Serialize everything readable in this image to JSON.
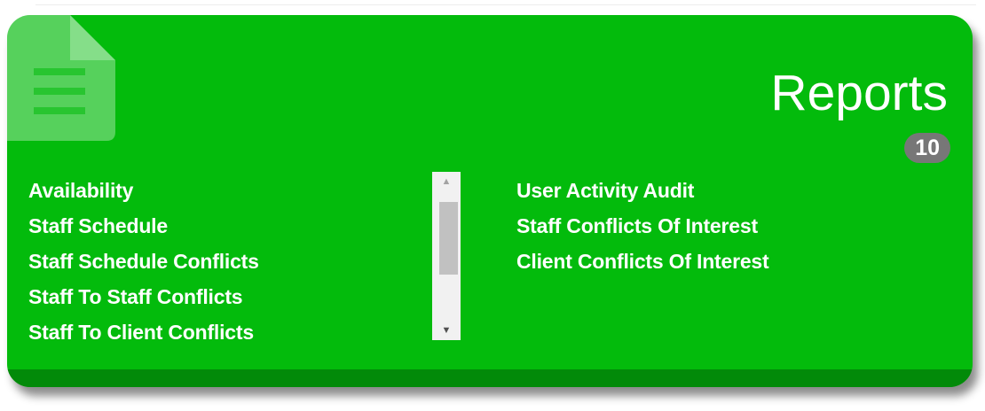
{
  "card": {
    "title": "Reports",
    "count": "10",
    "icon": "document-icon",
    "colors": {
      "background": "#03bb0c",
      "footer": "#028a09",
      "badge": "#777777"
    }
  },
  "reports_left": [
    "Availability",
    "Staff Schedule",
    "Staff Schedule Conflicts",
    "Staff To Staff Conflicts",
    "Staff To Client Conflicts"
  ],
  "reports_right": [
    "User Activity Audit",
    "Staff Conflicts Of Interest",
    "Client Conflicts Of Interest"
  ],
  "scrollbar": {
    "up_icon": "scroll-up-arrow-icon",
    "down_icon": "scroll-down-arrow-icon"
  }
}
